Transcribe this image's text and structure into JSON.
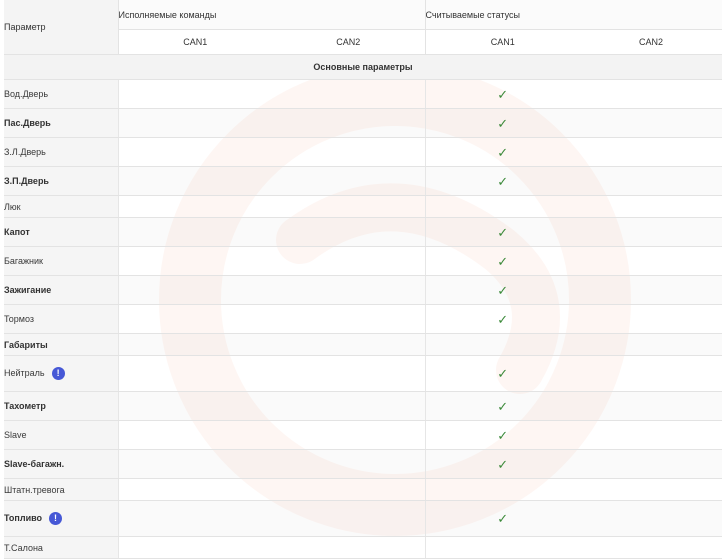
{
  "table": {
    "param_header": "Параметр",
    "cmd_group": "Исполняемые команды",
    "status_group": "Считываемые статусы",
    "cmd_can1": "CAN1",
    "cmd_can2": "CAN2",
    "st_can1": "CAN1",
    "st_can2": "CAN2",
    "section_title": "Основные параметры",
    "check_glyph": "✓",
    "info_glyph": "!",
    "rows": [
      {
        "name": "Вод.Дверь",
        "bold": false,
        "status_can1": true,
        "info": false,
        "icon": "check-icon"
      },
      {
        "name": "Пас.Дверь",
        "bold": true,
        "status_can1": true,
        "info": false,
        "icon": "check-icon"
      },
      {
        "name": "З.Л.Дверь",
        "bold": false,
        "status_can1": true,
        "info": false,
        "icon": "check-icon"
      },
      {
        "name": "З.П.Дверь",
        "bold": true,
        "status_can1": true,
        "info": false,
        "icon": "check-icon"
      },
      {
        "name": "Люк",
        "bold": false,
        "status_can1": false,
        "info": false
      },
      {
        "name": "Капот",
        "bold": true,
        "status_can1": true,
        "info": false,
        "icon": "check-icon"
      },
      {
        "name": "Багажник",
        "bold": false,
        "status_can1": true,
        "info": false,
        "icon": "check-icon"
      },
      {
        "name": "Зажигание",
        "bold": true,
        "status_can1": true,
        "info": false,
        "icon": "check-icon"
      },
      {
        "name": "Тормоз",
        "bold": false,
        "status_can1": true,
        "info": false,
        "icon": "check-icon"
      },
      {
        "name": "Габариты",
        "bold": true,
        "status_can1": false,
        "info": false
      },
      {
        "name": "Нейтраль",
        "bold": false,
        "status_can1": true,
        "info": true,
        "icon": "check-icon"
      },
      {
        "name": "Тахометр",
        "bold": true,
        "status_can1": true,
        "info": false,
        "icon": "check-icon"
      },
      {
        "name": "Slave",
        "bold": false,
        "status_can1": true,
        "info": false,
        "icon": "check-icon"
      },
      {
        "name": "Slave-багажн.",
        "bold": true,
        "status_can1": true,
        "info": false,
        "icon": "check-icon"
      },
      {
        "name": "Штатн.тревога",
        "bold": false,
        "status_can1": false,
        "info": false
      },
      {
        "name": "Топливо",
        "bold": true,
        "status_can1": true,
        "info": true,
        "icon": "check-icon"
      },
      {
        "name": "Т.Салона",
        "bold": false,
        "status_can1": false,
        "info": false
      }
    ]
  },
  "colors": {
    "check": "#3c8a3a",
    "info": "#4658d6",
    "watermark": "#f39a6e"
  }
}
